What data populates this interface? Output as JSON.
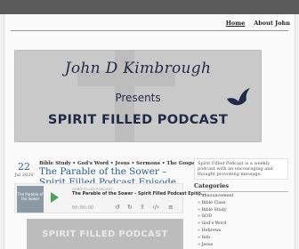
{
  "nav": {
    "home": "Home",
    "about": "About John"
  },
  "banner": {
    "name": "John D Kimbrough",
    "presents": "Presents",
    "podcast": "SPIRIT FILLED PODCAST"
  },
  "post": {
    "day": "22",
    "month": "Jul 2020",
    "categories": "Bible Study • God's Word • Jesus • Sermons • The Gospel",
    "title": "The Parable of the Sower – Spirit Filled Podcast Episode 115"
  },
  "player": {
    "art_text": "The Parable of the Sower",
    "podcast_name": "SPIRIT FILLED PODCAST",
    "episode_name": "The Parable of the Sower – Spirit Filled Podcast Episo...",
    "time": "00:00:00"
  },
  "thumbnail_text": "SPIRIT FILLED PODCAST",
  "sidebar": {
    "about": "Spirit Filled Podcast is a weekly podcast with an encouraging and thought provoking message.",
    "categories_heading": "Categories",
    "categories": [
      "announcement",
      "Bible Class",
      "Bible Study",
      "GOD",
      "God's Word",
      "Hebrews",
      "Info",
      "Jesus"
    ]
  },
  "colors": {
    "link": "#2a5d8a",
    "topbar": "#5a5a5a",
    "banner_text": "#1f2a44",
    "play": "#4aa35a"
  }
}
